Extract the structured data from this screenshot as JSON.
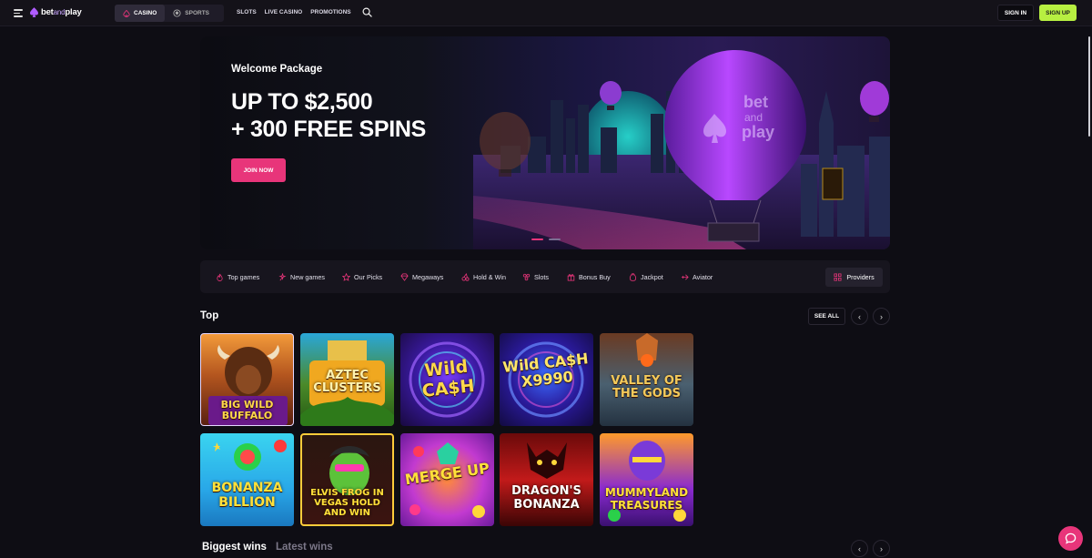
{
  "header": {
    "logo": {
      "part1": "bet",
      "part2": "and",
      "part3": "play"
    },
    "segments": [
      {
        "label": "CASINO"
      },
      {
        "label": "SPORTS"
      }
    ],
    "nav": [
      {
        "label": "SLOTS"
      },
      {
        "label": "LIVE CASINO"
      },
      {
        "label": "PROMOTIONS"
      }
    ],
    "signin_label": "SIGN IN",
    "signup_label": "SIGN UP"
  },
  "hero": {
    "subtitle": "Welcome Package",
    "title_line1": "UP TO $2,500",
    "title_line2": "+ 300 FREE SPINS",
    "cta_label": "JOIN NOW",
    "balloon_text1": "bet",
    "balloon_text2": "and",
    "balloon_text3": "play",
    "slides": 2,
    "active_slide": 1
  },
  "categories": [
    {
      "label": "Top games",
      "icon": "fire-icon"
    },
    {
      "label": "New games",
      "icon": "spark-icon"
    },
    {
      "label": "Our Picks",
      "icon": "star-icon"
    },
    {
      "label": "Megaways",
      "icon": "diamond-icon"
    },
    {
      "label": "Hold & Win",
      "icon": "cherries-icon"
    },
    {
      "label": "Slots",
      "icon": "slot-icon"
    },
    {
      "label": "Bonus Buy",
      "icon": "gift-icon"
    },
    {
      "label": "Jackpot",
      "icon": "jackpot-icon"
    },
    {
      "label": "Aviator",
      "icon": "plane-icon"
    }
  ],
  "providers_label": "Providers",
  "top": {
    "title": "Top",
    "see_all_label": "SEE ALL",
    "prev_label": "‹",
    "next_label": "›",
    "games": [
      {
        "title": "BIG WILD BUFFALO"
      },
      {
        "title": "AZTEC CLUSTERS"
      },
      {
        "title": "Wild CA$H"
      },
      {
        "title": "Wild CA$H X9990"
      },
      {
        "title": "VALLEY OF THE GODS"
      },
      {
        "title": "BONANZA BILLION"
      },
      {
        "title": "ELVIS FROG IN VEGAS HOLD AND WIN"
      },
      {
        "title": "MERGE UP"
      },
      {
        "title": "DRAGON'S BONANZA"
      },
      {
        "title": "MUMMYLAND TREASURES"
      }
    ]
  },
  "wins": {
    "biggest_label": "Biggest wins",
    "latest_label": "Latest wins",
    "prev_label": "‹",
    "next_label": "›"
  },
  "colors": {
    "accent": "#e8357a",
    "signup": "#b7ef41",
    "background": "#0e0d14"
  }
}
